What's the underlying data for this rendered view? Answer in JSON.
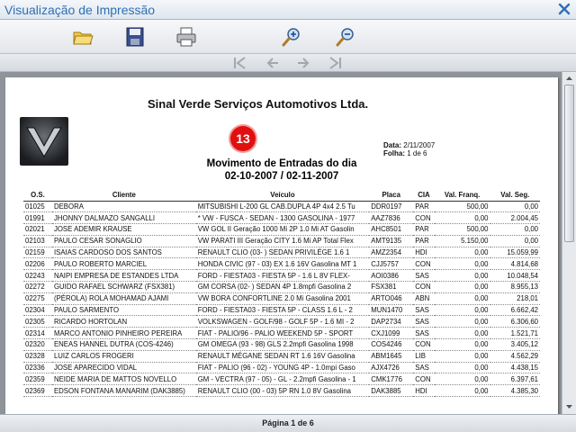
{
  "window": {
    "title": "Visualização de Impressão"
  },
  "toolbar": {
    "icons": [
      "open-folder-icon",
      "save-disk-icon",
      "printer-icon",
      "zoom-in-icon",
      "zoom-out-icon"
    ]
  },
  "nav": {
    "icons": [
      "first-page-icon",
      "previous-page-icon",
      "next-page-icon",
      "last-page-icon"
    ]
  },
  "report": {
    "company": "Sinal Verde Serviços Automotivos Ltda.",
    "badge": "13",
    "date_label": "Data:",
    "date_value": "2/11/2007",
    "page_label": "Folha:",
    "page_value": "1 de 6",
    "title_line1": "Movimento de Entradas do dia",
    "title_line2": "02-10-2007 / 02-11-2007",
    "columns": [
      "O.S.",
      "Cliente",
      "Veículo",
      "Placa",
      "CIA",
      "Val. Franq.",
      "Val. Seg."
    ],
    "rows": [
      [
        "01025",
        "DEBORA",
        "MITSUBISHI L-200 GL CAB.DUPLA 4P 4x4 2.5 Tu",
        "DDR0197",
        "PAR",
        "500,00",
        "0,00"
      ],
      [
        "01991",
        "JHONNY DALMAZO SANGALLI",
        "* VW - FUSCA - SEDAN - 1300 GASOLINA - 1977",
        "AAZ7836",
        "CON",
        "0,00",
        "2.004,45"
      ],
      [
        "02021",
        "JOSE ADEMIR KRAUSE",
        "VW GOL II Geração 1000 Mi 2P 1.0 Mi AT Gasolin",
        "AHC8501",
        "PAR",
        "500,00",
        "0,00"
      ],
      [
        "02103",
        "PAULO CESAR SONAGLIO",
        "VW PARATI III Geração CITY 1.6 Mi AP Total Flex",
        "AMT9135",
        "PAR",
        "5.150,00",
        "0,00"
      ],
      [
        "02159",
        "ISAIAS CARDOSO DOS SANTOS",
        "RENAULT CLIO (03- ) SEDAN PRIVILÉGE 1.6 1",
        "AMZ2354",
        "HDI",
        "0,00",
        "15.059,99"
      ],
      [
        "02206",
        "PAULO ROBERTO MARCIEL",
        "HONDA CIVIC (97 - 03) EX 1.6 16V Gasolina MT 1",
        "CJJ5757",
        "CON",
        "0,00",
        "4.814,68"
      ],
      [
        "02243",
        "NAIPI EMPRESA DE ESTANDES LTDA",
        "FORD - FIESTA03 - FIESTA 5P - 1.6 L 8V FLEX-",
        "AOI0386",
        "SAS",
        "0,00",
        "10.048,54"
      ],
      [
        "02272",
        "GUIDO RAFAEL SCHWARZ (FSX381)",
        "GM CORSA (02- ) SEDAN 4P 1.8mpfi Gasolina 2",
        "FSX381",
        "CON",
        "0,00",
        "8.955,13"
      ],
      [
        "02275",
        "(PÉROLA) ROLA MOHAMAD AJAMI",
        "VW BORA CONFORTLINE 2.0 Mi Gasolina 2001",
        "ARTO046",
        "ABN",
        "0,00",
        "218,01"
      ],
      [
        "02304",
        "PAULO SARMENTO",
        "FORD - FIESTA03 - FIESTA 5P - CLASS 1.6 L - 2",
        "MUN1470",
        "SAS",
        "0,00",
        "6.662,42"
      ],
      [
        "02305",
        "RICARDO HORTOLAN",
        "VOLKSWAGEN - GOLF/98 - GOLF 5P - 1.6 MI - 2",
        "DAP2734",
        "SAS",
        "0,00",
        "6.306,60"
      ],
      [
        "02314",
        "MARCO ANTONIO PINHEIRO PEREIRA",
        "FIAT - PALIO/96 - PALIO WEEKEND 5P - SPORT",
        "CXJ1099",
        "SAS",
        "0,00",
        "1.521,71"
      ],
      [
        "02320",
        "ENEAS HANNEL DUTRA (COS-4246)",
        "GM OMEGA (93 - 98) GLS 2.2mpfi Gasolina 1998",
        "COS4246",
        "CON",
        "0,00",
        "3.405,12"
      ],
      [
        "02328",
        "LUIZ CARLOS FROGERI",
        "RENAULT MÉGANE SEDAN RT 1.6 16V Gasolina",
        "ABM1645",
        "LIB",
        "0,00",
        "4.562,29"
      ],
      [
        "02336",
        "JOSE APARECIDO VIDAL",
        "FIAT - PALIO (96 - 02) - YOUNG 4P - 1.0mpi Gaso",
        "AJX4726",
        "SAS",
        "0,00",
        "4.438,15"
      ],
      [
        "02359",
        "NEIDE MARIA DE MATTOS NOVELLO",
        "GM - VECTRA (97 - 05) - GL - 2.2mpfi Gasolina - 1",
        "CMK1776",
        "CON",
        "0,00",
        "6.397,61"
      ],
      [
        "02369",
        "EDSON FONTANA MANARIM (DAK3885)",
        "RENAULT CLIO (00 - 03) 5P RN 1.0 8V Gasolina",
        "DAK3885",
        "HDI",
        "0,00",
        "4.385,30"
      ]
    ]
  },
  "status": {
    "page_info": "Página 1 de 6"
  }
}
